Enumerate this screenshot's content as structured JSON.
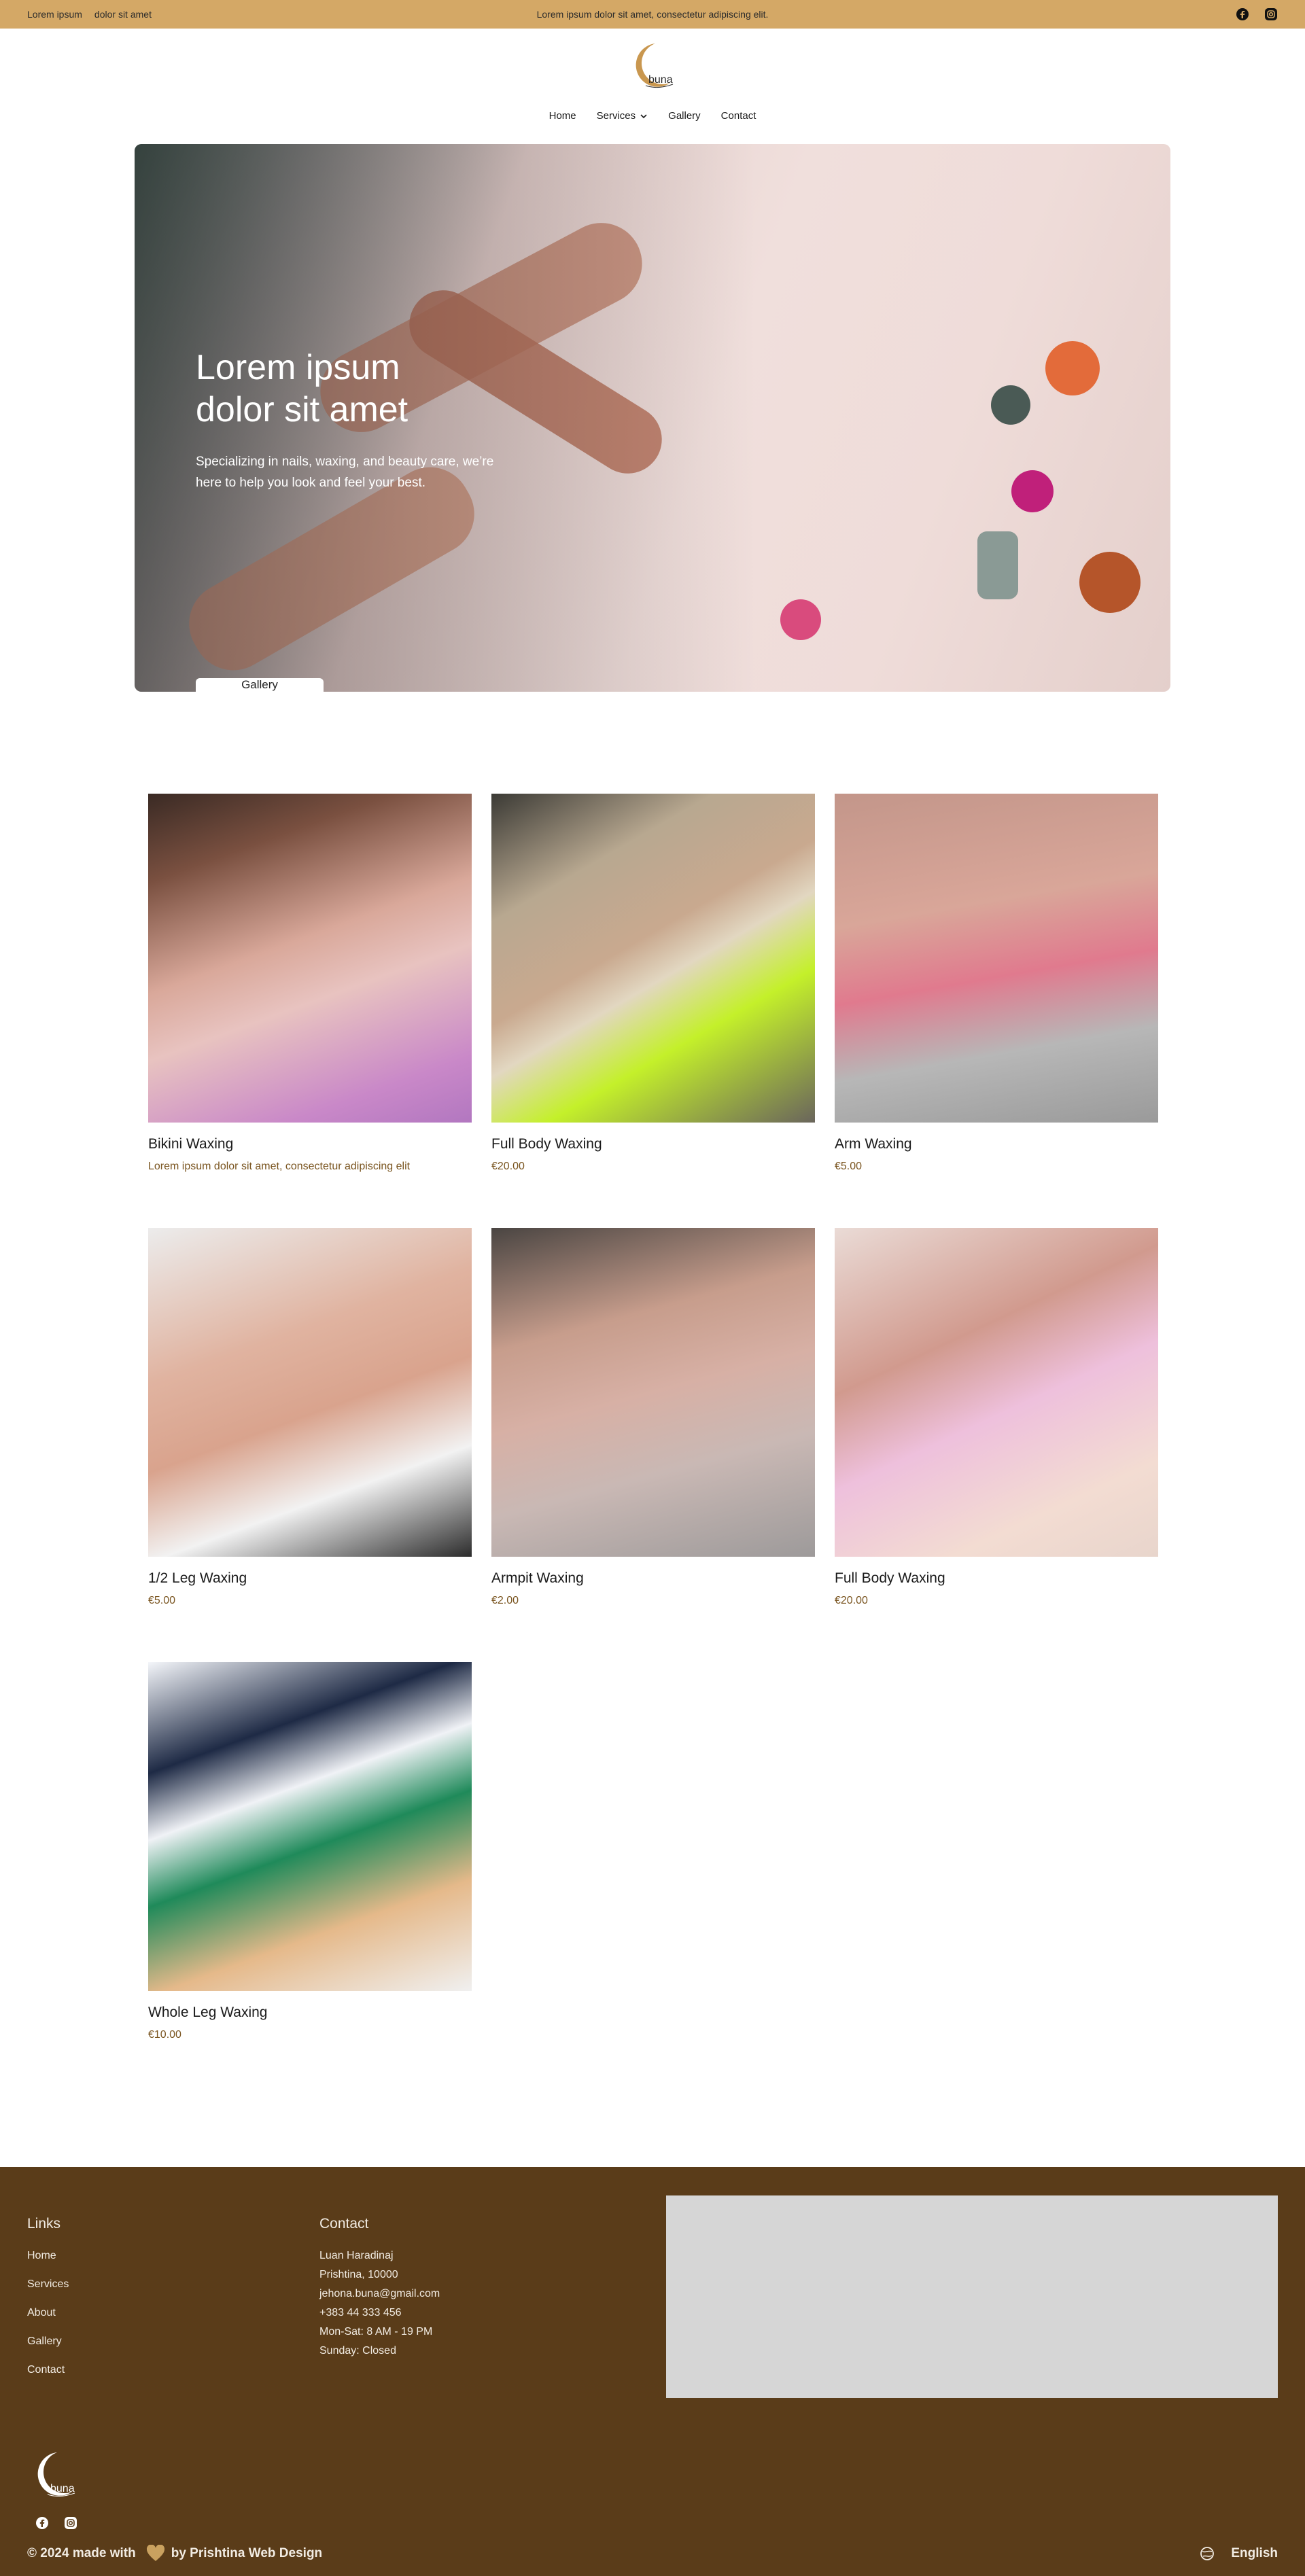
{
  "topbar": {
    "left_1": "Lorem ipsum",
    "left_2": "dolor sit amet",
    "center": "Lorem ipsum dolor sit amet, consectetur adipiscing elit."
  },
  "brand": {
    "name": "buna"
  },
  "nav": {
    "home": "Home",
    "services": "Services",
    "gallery": "Gallery",
    "contact": "Contact"
  },
  "hero": {
    "title": "Lorem ipsum dolor sit amet",
    "subtitle": "Specializing in nails, waxing, and beauty care, we’re here to help you look and feel your best.",
    "button": "Gallery"
  },
  "products": [
    {
      "title": "Bikini Waxing",
      "price": "Lorem ipsum dolor sit amet, consectetur adipiscing elit"
    },
    {
      "title": "Full Body Waxing",
      "price": "€20.00"
    },
    {
      "title": "Arm Waxing",
      "price": "€5.00"
    },
    {
      "title": "1/2 Leg Waxing",
      "price": "€5.00"
    },
    {
      "title": "Armpit Waxing",
      "price": "€2.00"
    },
    {
      "title": "Full Body Waxing",
      "price": "€20.00"
    },
    {
      "title": "Whole Leg Waxing",
      "price": "€10.00"
    }
  ],
  "footer": {
    "links_title": "Links",
    "links": [
      "Home",
      "Services",
      "About",
      "Gallery",
      "Contact"
    ],
    "contact_title": "Contact",
    "contact": [
      "Luan Haradinaj",
      "Prishtina, 10000",
      "jehona.buna@gmail.com",
      "+383 44 333 456",
      "Mon-Sat: 8 AM - 19 PM",
      "Sunday: Closed"
    ],
    "copyright_pre": "© 2024 made with",
    "copyright_post": "by Prishtina Web Design",
    "language": "English"
  },
  "colors": {
    "topbar": "#d4a866",
    "footer": "#5a3c19",
    "price": "#7a5520"
  },
  "icons": [
    "facebook-icon",
    "instagram-icon",
    "chevron-down-icon",
    "heart-icon",
    "globe-icon"
  ]
}
